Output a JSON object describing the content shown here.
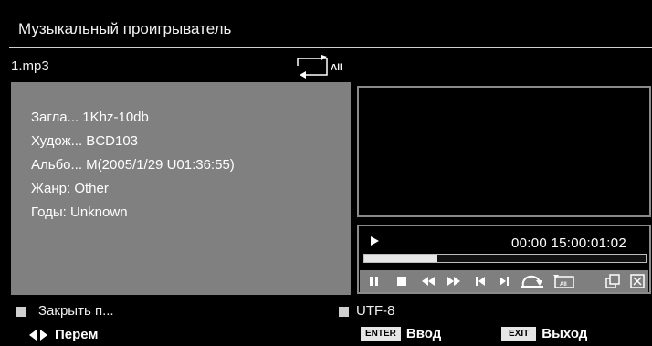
{
  "window": {
    "title": "Музыкальный проигрыватель"
  },
  "file": {
    "name": "1.mp3"
  },
  "repeat": {
    "mode_label": "All",
    "icon": "repeat-all-icon"
  },
  "info": [
    "Загла... 1Khz-10db",
    "Худож... BCD103",
    "Альбо... M(2005/1/29 U01:36:55)",
    "Жанр: Other",
    "Годы: Unknown"
  ],
  "player": {
    "state_icon": "play-icon",
    "time": "00:00 15:00:01:02",
    "progress_fraction": 0.26,
    "controls": [
      {
        "name": "pause-button",
        "icon": "pause-icon"
      },
      {
        "name": "stop-button",
        "icon": "stop-icon"
      },
      {
        "name": "rewind-button",
        "icon": "rewind-icon"
      },
      {
        "name": "fast-forward-button",
        "icon": "fast-forward-icon"
      },
      {
        "name": "previous-button",
        "icon": "skip-previous-icon"
      },
      {
        "name": "next-button",
        "icon": "skip-next-icon"
      },
      {
        "name": "repeat-button",
        "icon": "repeat-icon"
      },
      {
        "name": "repeat-all-button",
        "icon": "repeat-all-icon",
        "label": "All"
      },
      {
        "name": "playlist-button",
        "icon": "playlist-icon"
      },
      {
        "name": "close-player-button",
        "icon": "close-icon"
      }
    ]
  },
  "options": {
    "close_label": "Закрыть п...",
    "encoding_label": "UTF-8"
  },
  "footer": {
    "nav_label": "Перем",
    "enter_key": "ENTER",
    "enter_label": "Ввод",
    "exit_key": "EXIT",
    "exit_label": "Выход"
  },
  "colors": {
    "background": "#000000",
    "panel": "#808080",
    "control_strip": "#7f7f7f",
    "border": "#8a8a8a"
  }
}
